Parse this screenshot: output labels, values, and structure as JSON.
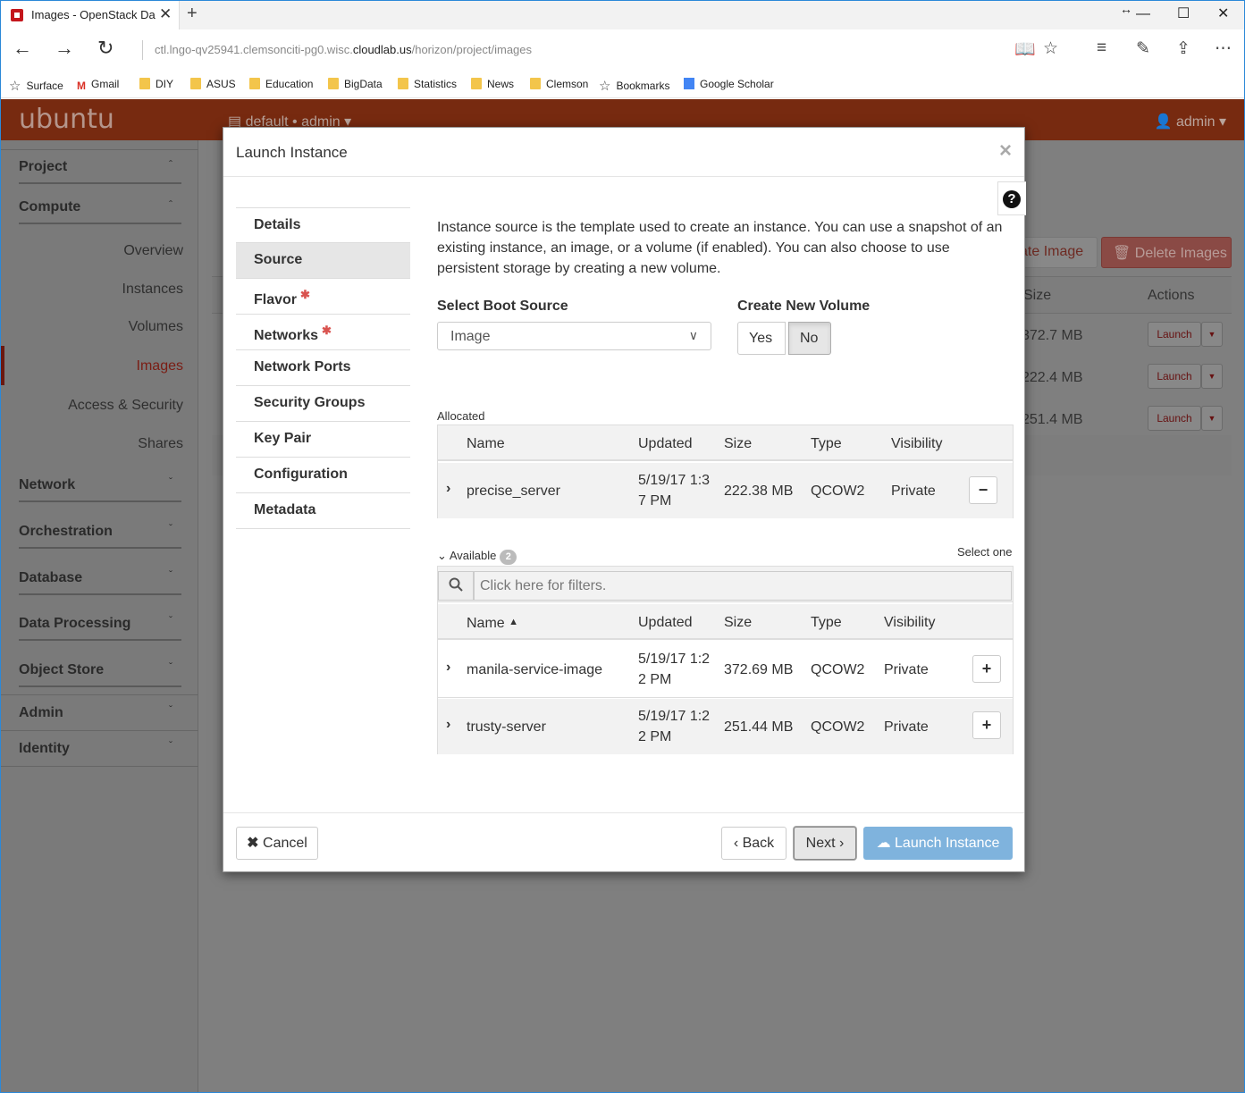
{
  "browser": {
    "tab_title": "Images - OpenStack Da",
    "url_prefix": "ctl.lngo-qv25941.clemsonciti-pg0.wisc.",
    "url_domain": "cloudlab.us",
    "url_path": "/horizon/project/images",
    "bookmarks": [
      "Surface",
      "Gmail",
      "DIY",
      "ASUS",
      "Education",
      "BigData",
      "Statistics",
      "News",
      "Clemson",
      "Bookmarks",
      "Google Scholar"
    ]
  },
  "header": {
    "logo": "ubuntu",
    "project_selector": "default • admin",
    "user": "admin"
  },
  "sidebar": {
    "project": "Project",
    "compute": "Compute",
    "items": [
      "Overview",
      "Instances",
      "Volumes",
      "Images",
      "Access & Security",
      "Shares"
    ],
    "sections": [
      "Network",
      "Orchestration",
      "Database",
      "Data Processing",
      "Object Store"
    ],
    "admin": "Admin",
    "identity": "Identity"
  },
  "background": {
    "create_image": "ate Image",
    "delete_images": "Delete Images",
    "col_size": "Size",
    "col_actions": "Actions",
    "sizes": [
      "372.7 MB",
      "222.4 MB",
      "251.4 MB"
    ],
    "launch": "Launch"
  },
  "modal": {
    "title": "Launch Instance",
    "steps": [
      {
        "label": "Details",
        "required": false
      },
      {
        "label": "Source",
        "required": false
      },
      {
        "label": "Flavor",
        "required": true
      },
      {
        "label": "Networks",
        "required": true
      },
      {
        "label": "Network Ports",
        "required": false
      },
      {
        "label": "Security Groups",
        "required": false
      },
      {
        "label": "Key Pair",
        "required": false
      },
      {
        "label": "Configuration",
        "required": false
      },
      {
        "label": "Metadata",
        "required": false
      }
    ],
    "description": "Instance source is the template used to create an instance. You can use a snapshot of an existing instance, an image, or a volume (if enabled). You can also choose to use persistent storage by creating a new volume.",
    "boot_source_label": "Select Boot Source",
    "boot_source_value": "Image",
    "new_volume_label": "Create New Volume",
    "yes": "Yes",
    "no": "No",
    "allocated_label": "Allocated",
    "columns": {
      "name": "Name",
      "updated": "Updated",
      "size": "Size",
      "type": "Type",
      "visibility": "Visibility"
    },
    "allocated": [
      {
        "name": "precise_server",
        "updated_1": "5/19/17 1:3",
        "updated_2": "7 PM",
        "size": "222.38 MB",
        "type": "QCOW2",
        "visibility": "Private"
      }
    ],
    "available_label": "Available",
    "available_count": "2",
    "select_one": "Select one",
    "filter_placeholder": "Click here for filters.",
    "available": [
      {
        "name": "manila-service-image",
        "updated_1": "5/19/17 1:2",
        "updated_2": "2 PM",
        "size": "372.69 MB",
        "type": "QCOW2",
        "visibility": "Private"
      },
      {
        "name": "trusty-server",
        "updated_1": "5/19/17 1:2",
        "updated_2": "2 PM",
        "size": "251.44 MB",
        "type": "QCOW2",
        "visibility": "Private"
      }
    ],
    "cancel": "Cancel",
    "back": "Back",
    "next": "Next",
    "launch": "Launch Instance"
  },
  "colors": {
    "brand": "#772a10",
    "accent": "#7fb3dd",
    "danger": "#d9534f"
  }
}
